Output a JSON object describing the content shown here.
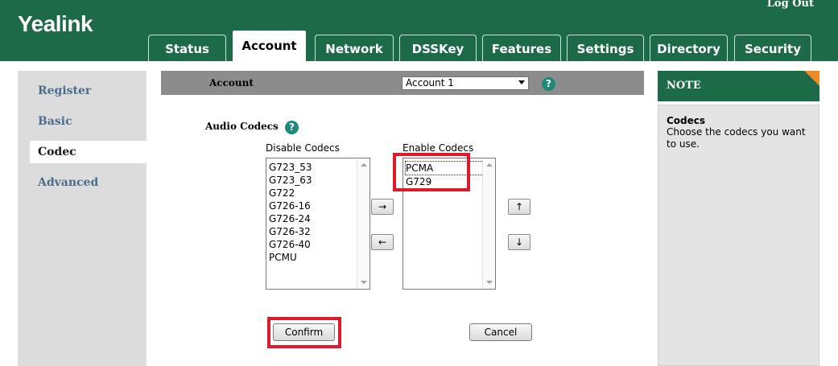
{
  "header": {
    "logo": "Yealink",
    "logout": "Log Out",
    "tabs": [
      {
        "label": "Status"
      },
      {
        "label": "Account"
      },
      {
        "label": "Network"
      },
      {
        "label": "DSSKey"
      },
      {
        "label": "Features"
      },
      {
        "label": "Settings"
      },
      {
        "label": "Directory"
      },
      {
        "label": "Security"
      }
    ],
    "active_tab": "Account"
  },
  "sidebar": {
    "items": [
      {
        "label": "Register"
      },
      {
        "label": "Basic"
      },
      {
        "label": "Codec"
      },
      {
        "label": "Advanced"
      }
    ],
    "active_item": "Codec"
  },
  "account_bar": {
    "label": "Account",
    "selected": "Account 1",
    "help": "?"
  },
  "codecs": {
    "section_title": "Audio Codecs",
    "help": "?",
    "disable_label": "Disable Codecs",
    "enable_label": "Enable Codecs",
    "disabled": [
      "G723_53",
      "G723_63",
      "G722",
      "G726-16",
      "G726-24",
      "G726-32",
      "G726-40",
      "PCMU"
    ],
    "enabled": [
      "PCMA",
      "G729"
    ],
    "move_right": "→",
    "move_left": "←",
    "move_up": "↑",
    "move_down": "↓"
  },
  "buttons": {
    "confirm": "Confirm",
    "cancel": "Cancel"
  },
  "note": {
    "header": "NOTE",
    "title": "Codecs",
    "text": "Choose the codecs you want to use."
  },
  "colors": {
    "brand_green": "#1d6a48",
    "highlight_red": "#dd1a2a",
    "note_corner": "#f08a24"
  }
}
